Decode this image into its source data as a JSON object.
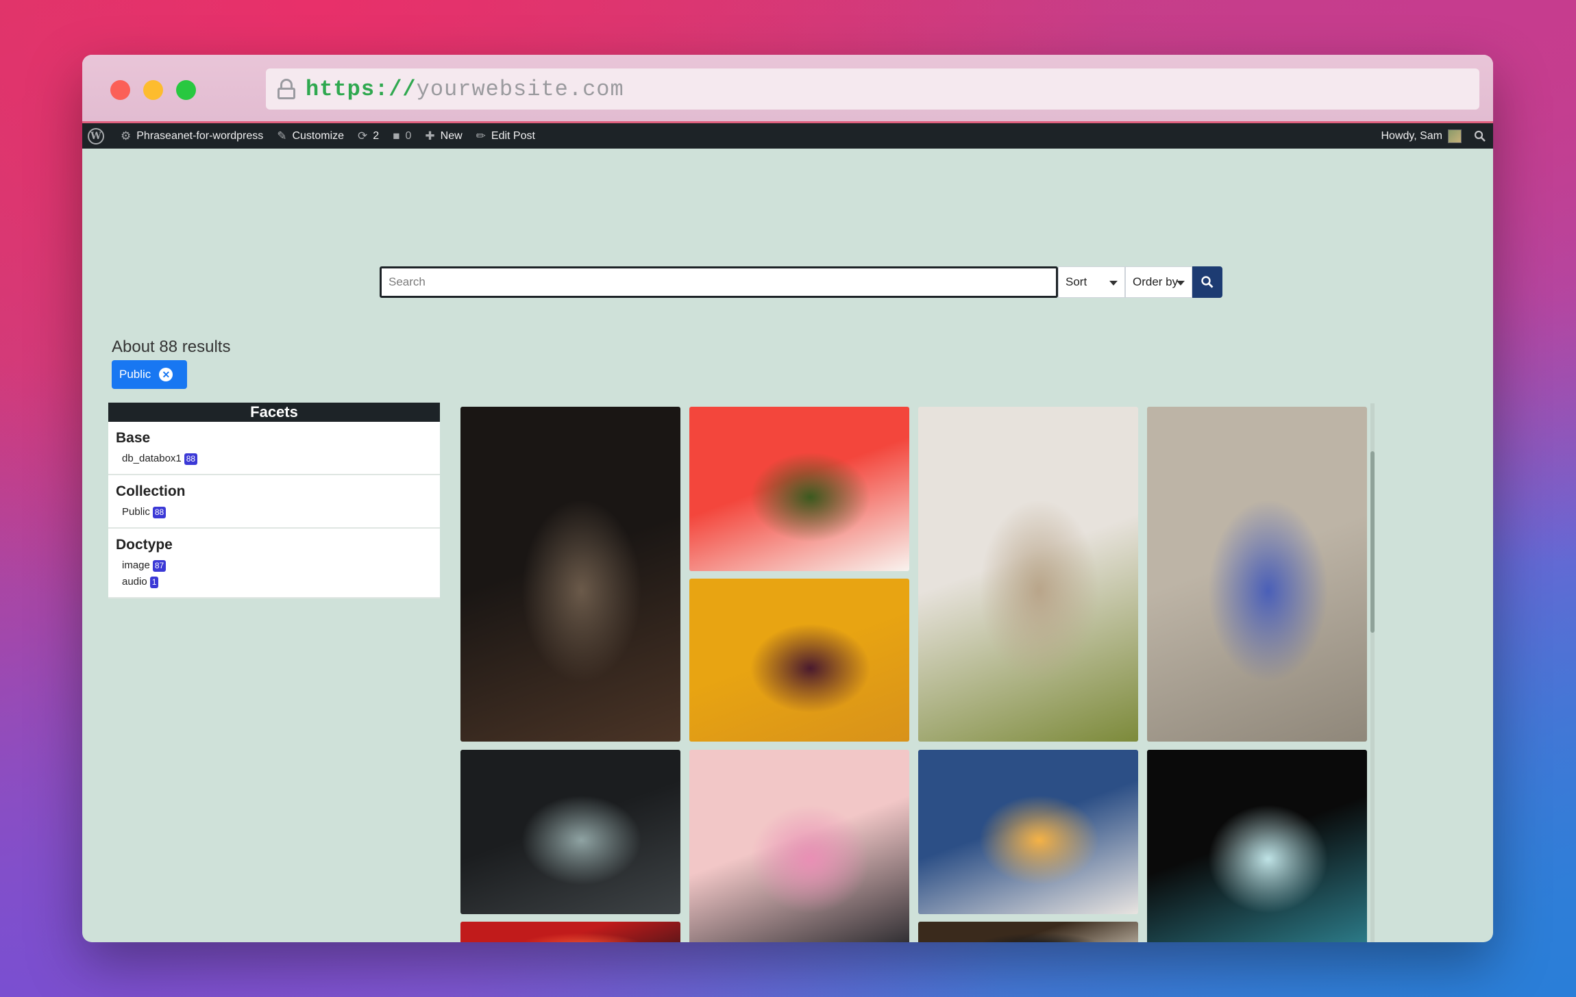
{
  "browser": {
    "url_scheme": "https://",
    "url_host": "yourwebsite.com"
  },
  "adminbar": {
    "site_name": "Phraseanet-for-wordpress",
    "customize": "Customize",
    "updates_count": "2",
    "comments_count": "0",
    "new_label": "New",
    "edit_post": "Edit Post",
    "howdy": "Howdy, Sam"
  },
  "search": {
    "placeholder": "Search",
    "sort_label": "Sort",
    "order_label": "Order by"
  },
  "results": {
    "summary": "About 88 results",
    "active_filter": "Public"
  },
  "facets": {
    "title": "Facets",
    "groups": [
      {
        "name": "Base",
        "options": [
          {
            "label": "db_databox1",
            "count": "88"
          }
        ]
      },
      {
        "name": "Collection",
        "options": [
          {
            "label": "Public",
            "count": "88"
          }
        ]
      },
      {
        "name": "Doctype",
        "options": [
          {
            "label": "image",
            "count": "87"
          },
          {
            "label": "audio",
            "count": "1"
          }
        ]
      }
    ]
  },
  "gallery": {
    "tiles": [
      {
        "name": "laptop-on-table",
        "colors": [
          "#1a1614",
          "#4a3426",
          "#6b5a4a"
        ]
      },
      {
        "name": "salad-bowl-red",
        "colors": [
          "#f3463c",
          "#f8f3ef",
          "#3b5a1f"
        ]
      },
      {
        "name": "pancake-berries-yellow",
        "colors": [
          "#e8a412",
          "#d8921a",
          "#4a1a2e"
        ]
      },
      {
        "name": "plant-in-room",
        "colors": [
          "#e7e2dc",
          "#7c8a3a",
          "#b9a58a"
        ]
      },
      {
        "name": "dancer-rock-wall",
        "colors": [
          "#bdb4a6",
          "#8f877a",
          "#4a5fb8"
        ]
      },
      {
        "name": "arched-pool-hall",
        "colors": [
          "#1b1d1f",
          "#3e4346",
          "#8fa3a3"
        ]
      },
      {
        "name": "crystals-pink-tray",
        "colors": [
          "#f2c7c7",
          "#2a2a2e",
          "#e98fb5"
        ]
      },
      {
        "name": "rocket-launch-spacex",
        "colors": [
          "#2c4f86",
          "#e8e4e0",
          "#f5b246"
        ]
      },
      {
        "name": "crypto-glass-sign",
        "colors": [
          "#0a0a0a",
          "#2d7e8c",
          "#bfe3e6"
        ]
      },
      {
        "name": "neon-street-night",
        "colors": [
          "#c11b1b",
          "#3a1418",
          "#e84a2e"
        ]
      },
      {
        "name": "enamel-mug",
        "colors": [
          "#3a2a1c",
          "#d7cfbf",
          "#1a1a1a"
        ]
      }
    ]
  }
}
